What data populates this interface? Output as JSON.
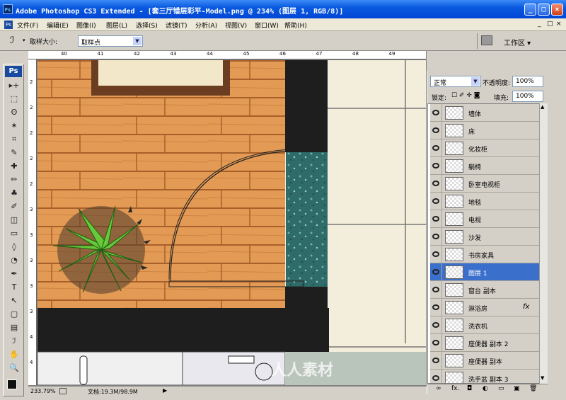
{
  "window": {
    "title": "Adobe Photoshop CS3 Extended - [套三厅错层彩平-Model.png @ 234% (图层 1, RGB/8)]",
    "app_icon": "Ps",
    "minimize": "_",
    "maximize": "□",
    "close": "×"
  },
  "menubar": {
    "items": [
      "文件(F)",
      "编辑(E)",
      "图像(I)",
      "图层(L)",
      "选择(S)",
      "滤镜(T)",
      "分析(A)",
      "视图(V)",
      "窗口(W)",
      "帮助(H)"
    ],
    "doc_controls": [
      "_",
      "□",
      "×"
    ]
  },
  "options_bar": {
    "sample_size_label": "取样大小:",
    "sample_size_value": "取样点",
    "workspace_label": "工作区 ▾"
  },
  "toolbox": {
    "logo": "Ps",
    "tools": [
      "move-icon",
      "marquee-icon",
      "lasso-icon",
      "magic-wand-icon",
      "crop-icon",
      "slice-icon",
      "healing-icon",
      "brush-icon",
      "stamp-icon",
      "history-brush-icon",
      "eraser-icon",
      "gradient-icon",
      "blur-icon",
      "dodge-icon",
      "pen-icon",
      "type-icon",
      "path-select-icon",
      "shape-icon",
      "notes-icon",
      "eyedropper-icon",
      "hand-icon",
      "zoom-icon"
    ],
    "tool_glyphs": [
      "▸+",
      "⬚",
      "ʘ",
      "✶",
      "⌗",
      "✎",
      "✚",
      "✏",
      "♣",
      "✐",
      "◫",
      "▭",
      "◊",
      "◔",
      "✒",
      "T",
      "↖",
      "▢",
      "▤",
      "ℐ",
      "✋",
      "🔍"
    ]
  },
  "rulers": {
    "horizontal": [
      "40",
      "41",
      "42",
      "43",
      "44",
      "45",
      "46",
      "47",
      "48",
      "49"
    ],
    "vertical": [
      "2",
      "2",
      "2",
      "2",
      "2",
      "3",
      "3",
      "3",
      "3",
      "3",
      "4",
      "4"
    ]
  },
  "status_bar": {
    "zoom": "233.79%",
    "doc_info": "文档:19.3M/98.9M"
  },
  "layers_panel": {
    "blend_mode": "正常",
    "opacity_label": "不透明度:",
    "opacity_value": "100%",
    "lock_label": "锁定:",
    "fill_label": "填充:",
    "fill_value": "100%",
    "layers": [
      {
        "name": "墙体",
        "selected": false,
        "fx": ""
      },
      {
        "name": "床",
        "selected": false,
        "fx": ""
      },
      {
        "name": "化妆柜",
        "selected": false,
        "fx": ""
      },
      {
        "name": "躺椅",
        "selected": false,
        "fx": ""
      },
      {
        "name": "卧室电视柜",
        "selected": false,
        "fx": ""
      },
      {
        "name": "地毯",
        "selected": false,
        "fx": ""
      },
      {
        "name": "电视",
        "selected": false,
        "fx": ""
      },
      {
        "name": "沙发",
        "selected": false,
        "fx": ""
      },
      {
        "name": "书房家具",
        "selected": false,
        "fx": ""
      },
      {
        "name": "图层 1",
        "selected": true,
        "fx": ""
      },
      {
        "name": "窗台 副本",
        "selected": false,
        "fx": ""
      },
      {
        "name": "淋浴房",
        "selected": false,
        "fx": "fx"
      },
      {
        "name": "洗衣机",
        "selected": false,
        "fx": ""
      },
      {
        "name": "座便器 副本 2",
        "selected": false,
        "fx": ""
      },
      {
        "name": "座便器 副本",
        "selected": false,
        "fx": ""
      },
      {
        "name": "洗手盆 副本 3",
        "selected": false,
        "fx": ""
      }
    ],
    "bottom_icons": [
      "link-icon",
      "fx-icon",
      "mask-icon",
      "adjustment-icon",
      "group-icon",
      "new-layer-icon",
      "trash-icon"
    ],
    "bottom_glyphs": [
      "∞",
      "fx.",
      "◘",
      "◐",
      "▭",
      "▣",
      "🗑"
    ]
  },
  "watermark": "人人素材",
  "colors": {
    "title_bar": "#0a5ae0",
    "selected_layer": "#3a6fcc",
    "wood_floor": "#e39a55",
    "wall": "#1e1e1e",
    "tile": "#f3eedb",
    "teal_stone": "#2e6b69"
  }
}
